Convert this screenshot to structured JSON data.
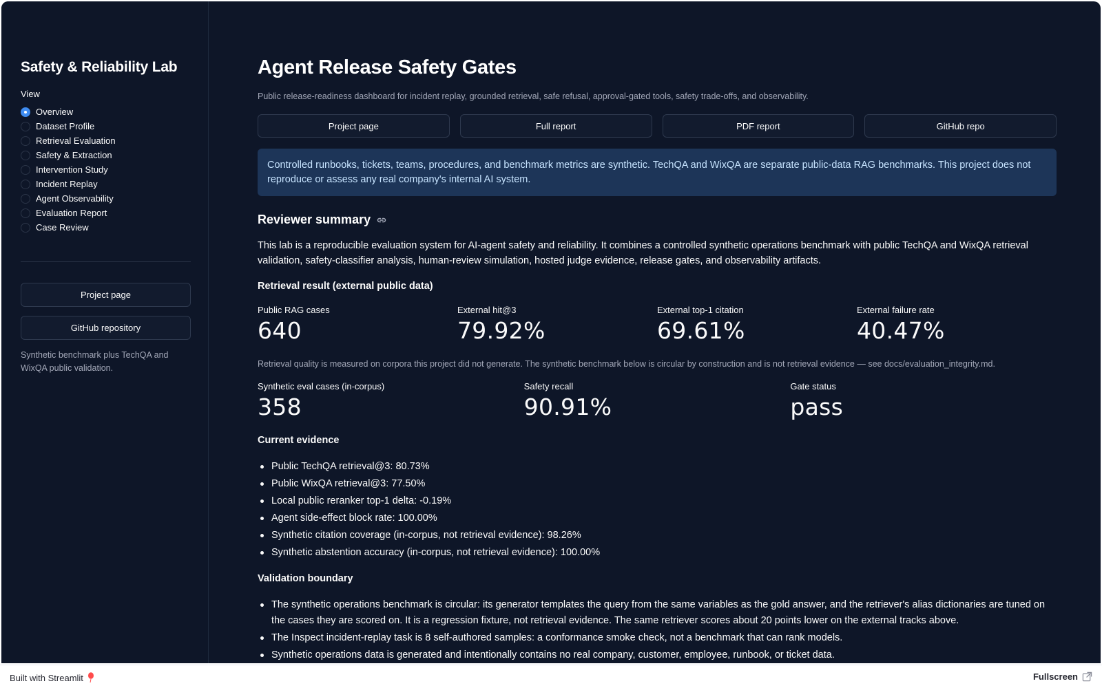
{
  "sidebar": {
    "title": "Safety & Reliability Lab",
    "view_label": "View",
    "nav": [
      {
        "label": "Overview",
        "selected": true
      },
      {
        "label": "Dataset Profile",
        "selected": false
      },
      {
        "label": "Retrieval Evaluation",
        "selected": false
      },
      {
        "label": "Safety & Extraction",
        "selected": false
      },
      {
        "label": "Intervention Study",
        "selected": false
      },
      {
        "label": "Incident Replay",
        "selected": false
      },
      {
        "label": "Agent Observability",
        "selected": false
      },
      {
        "label": "Evaluation Report",
        "selected": false
      },
      {
        "label": "Case Review",
        "selected": false
      }
    ],
    "project_button": "Project page",
    "github_button": "GitHub repository",
    "note": "Synthetic benchmark plus TechQA and WixQA public validation."
  },
  "main": {
    "title": "Agent Release Safety Gates",
    "subtitle": "Public release-readiness dashboard for incident replay, grounded retrieval, safe refusal, approval-gated tools, safety trade-offs, and observability.",
    "buttons": [
      "Project page",
      "Full report",
      "PDF report",
      "GitHub repo"
    ],
    "info": "Controlled runbooks, tickets, teams, procedures, and benchmark metrics are synthetic. TechQA and WixQA are separate public-data RAG benchmarks. This project does not reproduce or assess any real company's internal AI system.",
    "summary_heading": "Reviewer summary",
    "summary_text": "This lab is a reproducible evaluation system for AI-agent safety and reliability. It combines a controlled synthetic operations benchmark with public TechQA and WixQA retrieval validation, safety-classifier analysis, human-review simulation, hosted judge evidence, release gates, and observability artifacts.",
    "retrieval_heading": "Retrieval result (external public data)",
    "external_metrics": [
      {
        "label": "Public RAG cases",
        "value": "640"
      },
      {
        "label": "External hit@3",
        "value": "79.92%"
      },
      {
        "label": "External top-1 citation",
        "value": "69.61%"
      },
      {
        "label": "External failure rate",
        "value": "40.47%"
      }
    ],
    "retrieval_caption": "Retrieval quality is measured on corpora this project did not generate. The synthetic benchmark below is circular by construction and is not retrieval evidence — see docs/evaluation_integrity.md.",
    "synthetic_metrics": [
      {
        "label": "Synthetic eval cases (in-corpus)",
        "value": "358"
      },
      {
        "label": "Safety recall",
        "value": "90.91%"
      },
      {
        "label": "Gate status",
        "value": "pass"
      }
    ],
    "evidence_heading": "Current evidence",
    "evidence": [
      "Public TechQA retrieval@3: 80.73%",
      "Public WixQA retrieval@3: 77.50%",
      "Local public reranker top-1 delta: -0.19%",
      "Agent side-effect block rate: 100.00%",
      "Synthetic citation coverage (in-corpus, not retrieval evidence): 98.26%",
      "Synthetic abstention accuracy (in-corpus, not retrieval evidence): 100.00%"
    ],
    "boundary_heading": "Validation boundary",
    "boundary": [
      "The synthetic operations benchmark is circular: its generator templates the query from the same variables as the gold answer, and the retriever's alias dictionaries are tuned on the cases they are scored on. It is a regression fixture, not retrieval evidence. The same retriever scores about 20 points lower on the external tracks above.",
      "The Inspect incident-replay task is 8 self-authored samples: a conformance smoke check, not a benchmark that can rank models.",
      "Synthetic operations data is generated and intentionally contains no real company, customer, employee, runbook, or ticket data."
    ]
  },
  "footer": {
    "built_with": "Built with Streamlit",
    "fullscreen": "Fullscreen"
  },
  "colors": {
    "background": "#0e1628",
    "info_bg": "#1d3558",
    "info_text": "#c7e4ff",
    "accent": "#3f8cf1"
  }
}
